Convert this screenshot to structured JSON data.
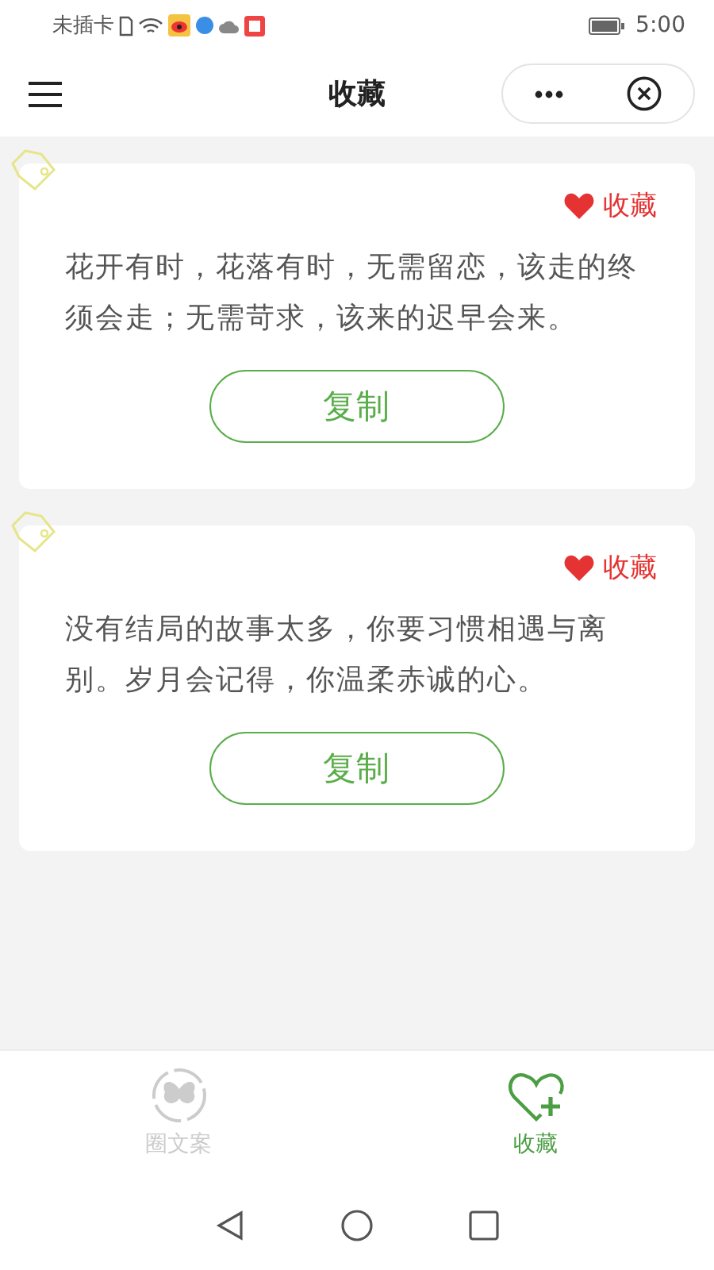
{
  "status_bar": {
    "carrier": "未插卡",
    "time": "5:00"
  },
  "header": {
    "title": "收藏"
  },
  "cards": [
    {
      "text": "花开有时，花落有时，无需留恋，该走的终须会走；无需苛求，该来的迟早会来。",
      "favorite_label": "收藏",
      "button": "复制"
    },
    {
      "text": "没有结局的故事太多，你要习惯相遇与离别。岁月会记得，你温柔赤诚的心。",
      "favorite_label": "收藏",
      "button": "复制"
    }
  ],
  "tabs": [
    {
      "label": "圈文案",
      "kind": "butterfly",
      "selected": false
    },
    {
      "label": "收藏",
      "kind": "heart",
      "selected": true
    }
  ]
}
